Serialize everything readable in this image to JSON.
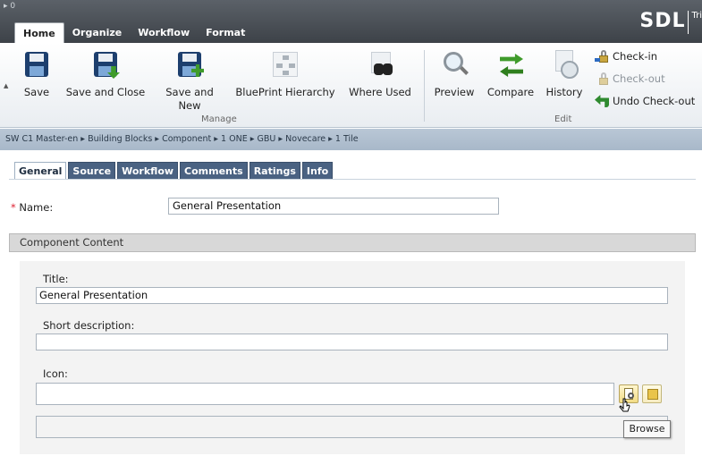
{
  "window": {
    "quick_access": "0"
  },
  "brand": {
    "name": "SDL",
    "product_partial": "Tri"
  },
  "ribbon_tabs": [
    {
      "label": "Home",
      "active": true
    },
    {
      "label": "Organize",
      "active": false
    },
    {
      "label": "Workflow",
      "active": false
    },
    {
      "label": "Format",
      "active": false
    }
  ],
  "ribbon": {
    "manage": {
      "group_label": "Manage",
      "save": "Save",
      "save_and_close": "Save and Close",
      "save_and_new_line1": "Save and",
      "save_and_new_line2": "New",
      "blueprint_hierarchy": "BluePrint Hierarchy",
      "where_used": "Where Used"
    },
    "edit": {
      "group_label": "Edit",
      "preview": "Preview",
      "compare": "Compare",
      "history": "History",
      "check_in": "Check-in",
      "check_out": "Check-out",
      "undo_check_out": "Undo Check-out"
    }
  },
  "breadcrumb": "SW C1 Master-en ▸ Building Blocks ▸ Component ▸ 1 ONE ▸ GBU ▸ Novecare ▸ 1 Tile",
  "content_tabs": [
    {
      "label": "General",
      "active": true
    },
    {
      "label": "Source",
      "active": false
    },
    {
      "label": "Workflow",
      "active": false
    },
    {
      "label": "Comments",
      "active": false
    },
    {
      "label": "Ratings",
      "active": false
    },
    {
      "label": "Info",
      "active": false
    }
  ],
  "form": {
    "required_mark": "*",
    "name_label": "Name:",
    "name_value": "General Presentation",
    "section_title": "Component Content",
    "title_label": "Title:",
    "title_value": "General Presentation",
    "short_description_label": "Short description:",
    "short_description_value": "",
    "icon_label": "Icon:",
    "icon_value": "",
    "extra_value": ""
  },
  "tooltip": {
    "browse": "Browse"
  },
  "colors": {
    "top_bar": "#4a5056",
    "breadcrumb_bar": "#aebdce",
    "tab_blue": "#4a6282",
    "required": "#dd2233"
  },
  "icons": {
    "save": "floppy-disk-icon",
    "blueprint": "hierarchy-icon",
    "where_used": "binoculars-icon",
    "preview": "magnifier-icon",
    "compare": "compare-arrows-icon",
    "history": "history-clock-icon",
    "check_in": "lock-icon",
    "browse": "browse-icon",
    "folder": "folder-icon"
  }
}
